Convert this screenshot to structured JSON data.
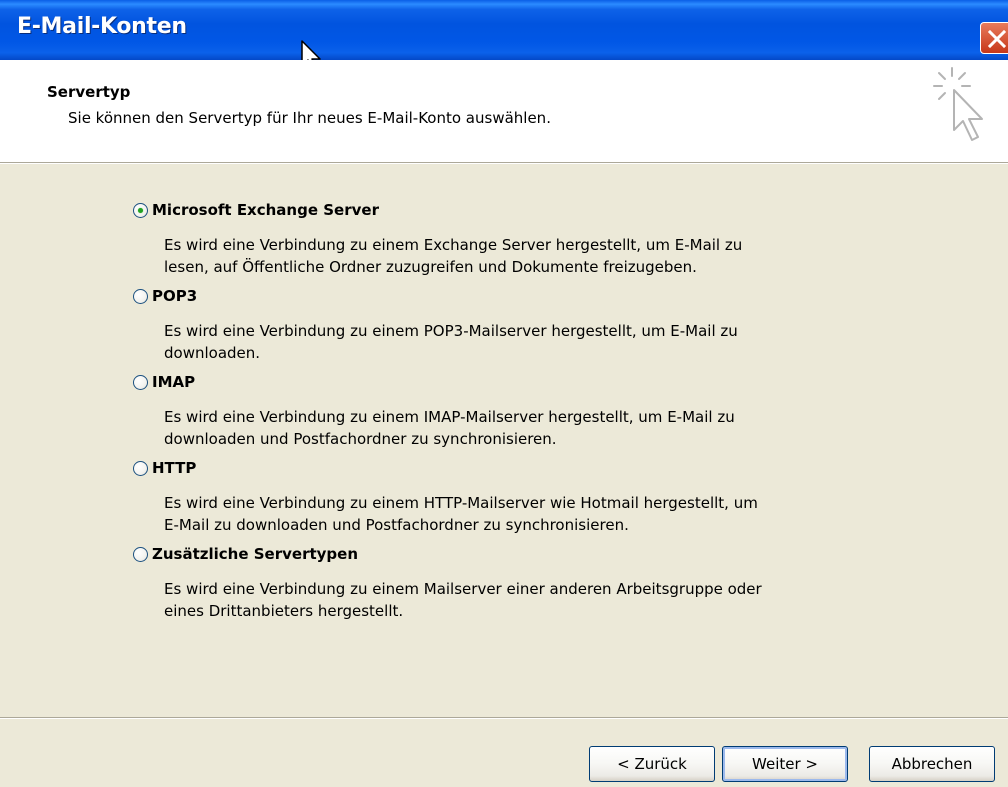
{
  "window": {
    "title": "E-Mail-Konten"
  },
  "header": {
    "title": "Servertyp",
    "subtitle": "Sie können den Servertyp für Ihr neues E-Mail-Konto auswählen."
  },
  "options": [
    {
      "label": "Microsoft Exchange Server",
      "checked": true,
      "desc": [
        "Es wird eine Verbindung zu einem Exchange Server hergestellt, um E-Mail zu",
        "lesen, auf Öffentliche Ordner zuzugreifen und Dokumente freizugeben."
      ]
    },
    {
      "label": "POP3",
      "checked": false,
      "desc": [
        "Es wird eine Verbindung zu einem POP3-Mailserver hergestellt, um E-Mail zu",
        "downloaden."
      ]
    },
    {
      "label": "IMAP",
      "checked": false,
      "desc": [
        "Es wird eine Verbindung zu einem IMAP-Mailserver hergestellt, um E-Mail zu",
        "downloaden und Postfachordner zu synchronisieren."
      ]
    },
    {
      "label": "HTTP",
      "checked": false,
      "desc": [
        "Es wird eine Verbindung zu einem HTTP-Mailserver wie Hotmail hergestellt, um",
        "E-Mail zu downloaden und Postfachordner zu synchronisieren."
      ]
    },
    {
      "label": "Zusätzliche Servertypen",
      "checked": false,
      "desc": [
        "Es wird eine Verbindung zu einem Mailserver einer anderen Arbeitsgruppe oder",
        "eines Drittanbieters hergestellt."
      ]
    }
  ],
  "buttons": {
    "back": "< Zurück",
    "next": "Weiter >",
    "cancel": "Abbrechen"
  },
  "colors": {
    "titlebar": "#0154DF",
    "dialog_bg": "#ECE9D8",
    "radio_checked": "#21A121",
    "close": "#C7381A"
  }
}
